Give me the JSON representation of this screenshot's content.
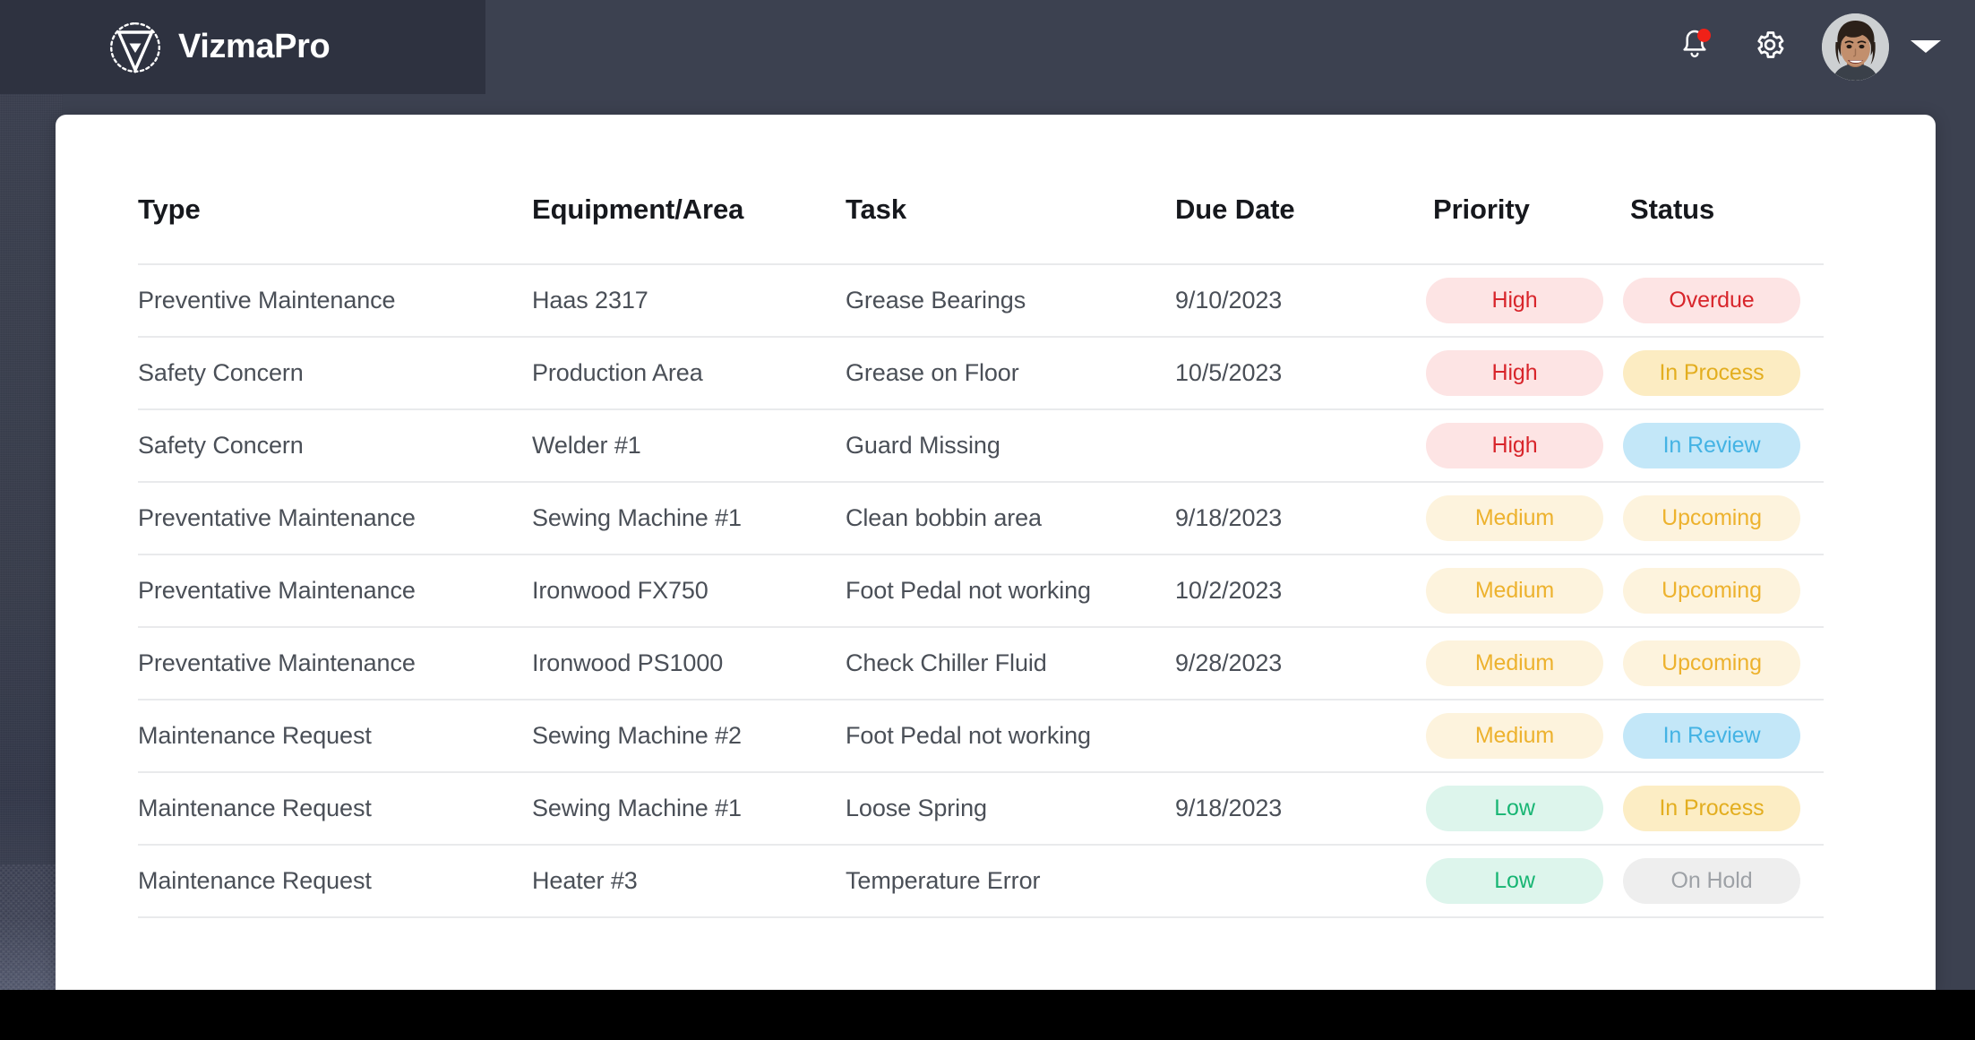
{
  "header": {
    "logo_text": "VizmaPro",
    "logo_icon": "triangle-gear-logo",
    "notification_icon": "bell-icon",
    "notification_badge": "",
    "settings_icon": "gear-icon",
    "avatar_icon": "user-avatar",
    "caret_icon": "chevron-down-icon"
  },
  "table": {
    "columns": [
      {
        "key": "type",
        "label": "Type"
      },
      {
        "key": "equip",
        "label": "Equipment/Area"
      },
      {
        "key": "task",
        "label": "Task"
      },
      {
        "key": "due",
        "label": "Due Date"
      },
      {
        "key": "priority",
        "label": "Priority"
      },
      {
        "key": "status",
        "label": "Status"
      }
    ],
    "rows": [
      {
        "type": "Preventive Maintenance",
        "equip": "Haas 2317",
        "task": "Grease Bearings",
        "due": "9/10/2023",
        "priority": "High",
        "priority_class": "badge-high",
        "status": "Overdue",
        "status_class": "badge-overdue"
      },
      {
        "type": "Safety Concern",
        "equip": "Production Area",
        "task": "Grease on Floor",
        "due": "10/5/2023",
        "priority": "High",
        "priority_class": "badge-high",
        "status": "In Process",
        "status_class": "badge-inprocess"
      },
      {
        "type": "Safety Concern",
        "equip": "Welder #1",
        "task": "Guard Missing",
        "due": "",
        "priority": "High",
        "priority_class": "badge-high",
        "status": "In Review",
        "status_class": "badge-inreview"
      },
      {
        "type": "Preventative Maintenance",
        "equip": "Sewing Machine #1",
        "task": "Clean bobbin area",
        "due": "9/18/2023",
        "priority": "Medium",
        "priority_class": "badge-medium",
        "status": "Upcoming",
        "status_class": "badge-upcoming"
      },
      {
        "type": "Preventative Maintenance",
        "equip": "Ironwood FX750",
        "task": "Foot Pedal not working",
        "due": "10/2/2023",
        "priority": "Medium",
        "priority_class": "badge-medium",
        "status": "Upcoming",
        "status_class": "badge-upcoming"
      },
      {
        "type": "Preventative Maintenance",
        "equip": "Ironwood PS1000",
        "task": "Check Chiller Fluid",
        "due": "9/28/2023",
        "priority": "Medium",
        "priority_class": "badge-medium",
        "status": "Upcoming",
        "status_class": "badge-upcoming"
      },
      {
        "type": "Maintenance Request",
        "equip": "Sewing Machine #2",
        "task": "Foot Pedal not working",
        "due": "",
        "priority": "Medium",
        "priority_class": "badge-medium",
        "status": "In Review",
        "status_class": "badge-inreview"
      },
      {
        "type": "Maintenance Request",
        "equip": "Sewing Machine #1",
        "task": "Loose Spring",
        "due": "9/18/2023",
        "priority": "Low",
        "priority_class": "badge-low",
        "status": "In Process",
        "status_class": "badge-inprocess-soft"
      },
      {
        "type": "Maintenance Request",
        "equip": "Heater #3",
        "task": "Temperature Error",
        "due": "",
        "priority": "Low",
        "priority_class": "badge-low",
        "status": "On Hold",
        "status_class": "badge-onhold"
      }
    ]
  },
  "colors": {
    "header_bg": "#3c4150",
    "logo_block_bg": "#2e3240",
    "card_bg": "#ffffff",
    "divider": "#e9eaec",
    "notification_dot": "#f02118",
    "priority_high_text": "#d8252b",
    "priority_medium_text": "#edb22e",
    "priority_low_text": "#17b573",
    "status_inreview_text": "#44b3e4",
    "status_onhold_text": "#9da1a6"
  }
}
